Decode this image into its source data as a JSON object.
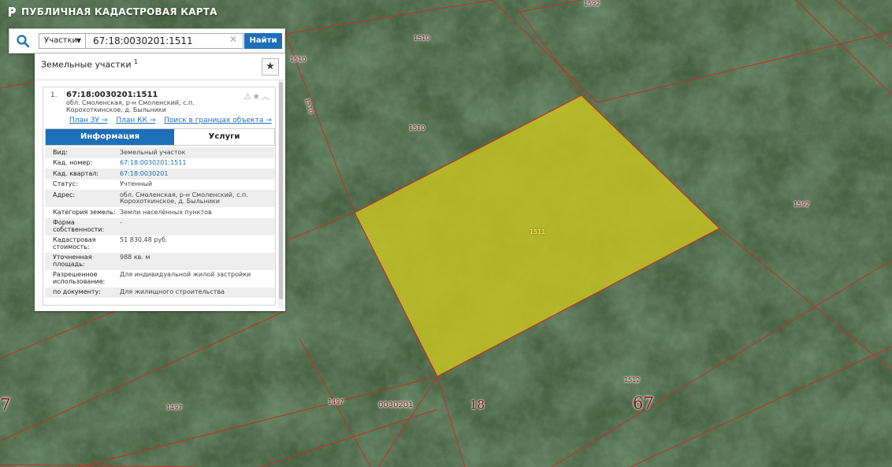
{
  "app": {
    "title": "ПУБЛИЧНАЯ КАДАСТРОВАЯ КАРТА"
  },
  "search": {
    "type_label": "Участки",
    "query": "67:18:0030201:1511",
    "find_label": "Найти"
  },
  "panel": {
    "header": "Земельные участки",
    "count": "1",
    "result": {
      "index": "1.",
      "cad_number": "67:18:0030201:1511",
      "address": "обл. Смоленская, р-н Смоленский, с.п. Корохоткинское, д. Быльники",
      "links": [
        "План ЗУ →",
        "План КК →",
        "Поиск в границах объекта →"
      ],
      "tabs": {
        "info": "Информация",
        "services": "Услуги"
      },
      "attributes": [
        {
          "key": "Вид:",
          "value": "Земельный участок"
        },
        {
          "key": "Кад. номер:",
          "value": "67:18:0030201:1511",
          "link": true
        },
        {
          "key": "Кад. квартал:",
          "value": "67:18:0030201",
          "link": true
        },
        {
          "key": "Статус:",
          "value": "Учтенный"
        },
        {
          "key": "Адрес:",
          "value": "обл. Смоленская, р-н Смоленский, с.п. Корохоткинское, д. Быльники"
        },
        {
          "key": "Категория земель:",
          "value": "Земли населённых пунктов"
        },
        {
          "key": "Форма собственности:",
          "value": "-"
        },
        {
          "key": "Кадастровая стоимость:",
          "value": "51 830,48 руб."
        },
        {
          "key": "Уточненная площадь:",
          "value": "988 кв. м"
        },
        {
          "key": "Разрешенное использование:",
          "value": "Для индивидуальной жилой застройки"
        },
        {
          "key": "по документу:",
          "value": "Для жилищного строительства"
        }
      ]
    }
  },
  "map": {
    "parcel_labels": [
      "1592",
      "1510",
      "1510",
      "1510",
      "1510",
      "1592",
      "1512",
      "1497",
      "1497"
    ],
    "highlighted_label": "1511",
    "quarter_label": "0030201",
    "district_label": "18",
    "region_label": "67",
    "edge_region_label": "7",
    "colors": {
      "parcel_border": "#c0302a",
      "highlight_fill": "#c8c520",
      "panel_accent": "#1d6fb8"
    }
  }
}
